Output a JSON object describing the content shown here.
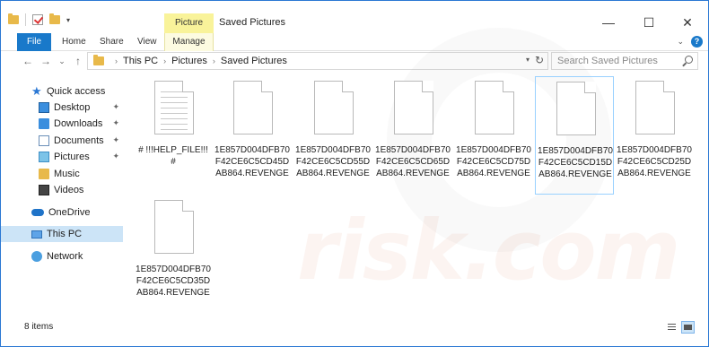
{
  "window": {
    "title": "Saved Pictures",
    "contextual_tab": "Picture Tools",
    "controls": [
      "—",
      "☐",
      "✕"
    ]
  },
  "ribbon": {
    "tabs": [
      "File",
      "Home",
      "Share",
      "View",
      "Manage"
    ],
    "expand_glyph": "⌄",
    "help_glyph": "?"
  },
  "address": {
    "crumbs": [
      "This PC",
      "Pictures",
      "Saved Pictures"
    ],
    "search_placeholder": "Search Saved Pictures"
  },
  "nav_buttons": [
    "←",
    "→",
    "⌄",
    "↑"
  ],
  "navigation": {
    "quick_access": "Quick access",
    "items": [
      {
        "label": "Desktop",
        "icon": "desktop-icon",
        "pinned": true
      },
      {
        "label": "Downloads",
        "icon": "downloads-icon",
        "pinned": true
      },
      {
        "label": "Documents",
        "icon": "documents-icon",
        "pinned": true
      },
      {
        "label": "Pictures",
        "icon": "pictures-icon",
        "pinned": true
      },
      {
        "label": "Music",
        "icon": "music-icon",
        "pinned": false
      },
      {
        "label": "Videos",
        "icon": "videos-icon",
        "pinned": false
      }
    ],
    "onedrive": "OneDrive",
    "this_pc": "This PC",
    "network": "Network",
    "selected": "This PC"
  },
  "files": [
    {
      "name": "# !!!HELP_FILE!!! #",
      "kind": "text"
    },
    {
      "name": "1E857D004DFB70F42CE6C5CD45DAB864.REVENGE",
      "kind": "blank"
    },
    {
      "name": "1E857D004DFB70F42CE6C5CD55DAB864.REVENGE",
      "kind": "blank"
    },
    {
      "name": "1E857D004DFB70F42CE6C5CD65DAB864.REVENGE",
      "kind": "blank"
    },
    {
      "name": "1E857D004DFB70F42CE6C5CD75DAB864.REVENGE",
      "kind": "blank"
    },
    {
      "name": "1E857D004DFB70F42CE6C5CD15DAB864.REVENGE",
      "kind": "blank",
      "selected": true
    },
    {
      "name": "1E857D004DFB70F42CE6C5CD25DAB864.REVENGE",
      "kind": "blank"
    },
    {
      "name": "1E857D004DFB70F42CE6C5CD35DAB864.REVENGE",
      "kind": "blank"
    }
  ],
  "status": {
    "item_count": "8 items"
  },
  "watermark": "risk.com",
  "colors": {
    "accent": "#1979ca",
    "contextual": "#f9f39a",
    "selection": "#cce4f7"
  }
}
